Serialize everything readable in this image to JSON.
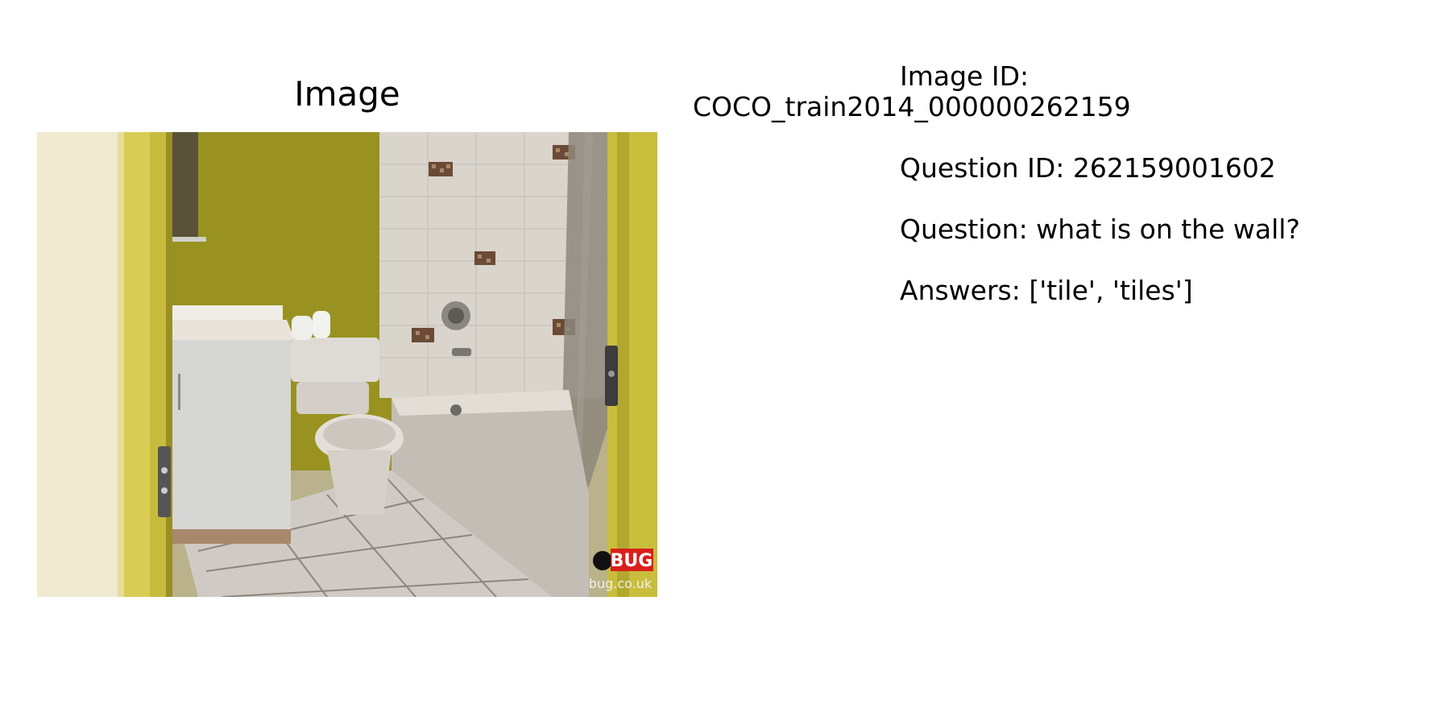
{
  "panel_title": "Image",
  "photo": {
    "watermark_brand": "BUG",
    "watermark_url": "bug.co.uk",
    "brand_color": "#d8201a"
  },
  "info": {
    "image_id_label": "Image ID:",
    "image_id_value": "COCO_train2014_000000262159",
    "question_id_label": "Question ID:",
    "question_id_value": "262159001602",
    "question_label": "Question:",
    "question_value": "what is on the wall?",
    "answers_label": "Answers:",
    "answers_value": "['tile', 'tiles']"
  }
}
